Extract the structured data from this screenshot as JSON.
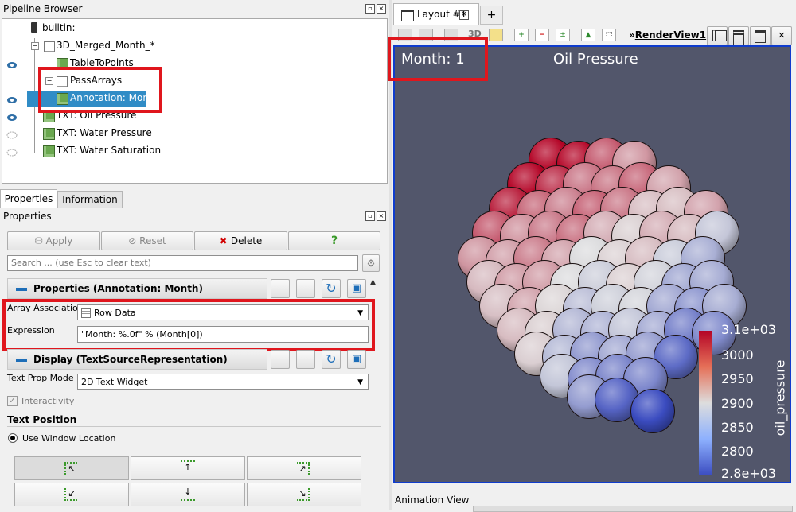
{
  "pipeline": {
    "title": "Pipeline Browser",
    "items": [
      {
        "label": "builtin:"
      },
      {
        "label": "3D_Merged_Month_*"
      },
      {
        "label": "TableToPoints"
      },
      {
        "label": "PassArrays"
      },
      {
        "label": "Annotation: Month"
      },
      {
        "label": "TXT: Oil Pressure"
      },
      {
        "label": "TXT: Water Pressure"
      },
      {
        "label": "TXT: Water Saturation"
      }
    ]
  },
  "tabs": {
    "properties": "Properties",
    "information": "Information"
  },
  "properties_panel": {
    "title": "Properties",
    "apply": "Apply",
    "reset": "Reset",
    "delete": "Delete",
    "help": "?",
    "search_placeholder": "Search ... (use Esc to clear text)",
    "section_properties": "Properties (Annotation: Month)",
    "array_association_label": "Array Association",
    "array_association_value": "Row Data",
    "expression_label": "Expression",
    "expression_value": "\"Month: %.0f\" % (Month[0])",
    "section_display": "Display (TextSourceRepresentation)",
    "text_prop_mode_label": "Text Prop Mode",
    "text_prop_mode_value": "2D Text Widget",
    "interactivity": "Interactivity",
    "text_position": "Text Position",
    "use_window_location": "Use Window Location"
  },
  "layout": {
    "tab_label": "Layout #1",
    "add_tab": "+",
    "view_name": "RenderView1",
    "toolbar_3d": "3D"
  },
  "render_view": {
    "annotation": "Month: 1",
    "title": "Oil Pressure",
    "colorbar_title": "oil_pressure",
    "colorbar_ticks": [
      "3.1e+03",
      "3000",
      "2950",
      "2900",
      "2850",
      "2800",
      "2.8e+03"
    ],
    "colors": {
      "high": "#b40426",
      "mid": "#dddddd",
      "low": "#3b4cc0",
      "background": "#52566b"
    }
  },
  "animation_view": "Animation View"
}
